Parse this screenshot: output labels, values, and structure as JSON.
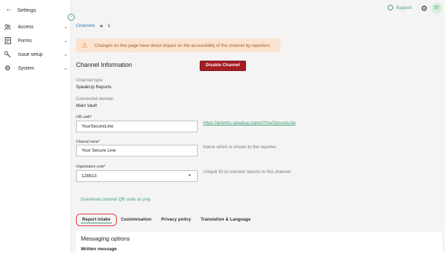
{
  "sidebar": {
    "title": "Settings",
    "items": [
      {
        "label": "Access",
        "icon": "users-icon"
      },
      {
        "label": "Forms",
        "icon": "form-icon"
      },
      {
        "label": "Issue setup",
        "icon": "wrench-icon"
      },
      {
        "label": "System",
        "icon": "gear-icon"
      }
    ]
  },
  "topbar": {
    "support_label": "Support",
    "avatar_initials": "ST"
  },
  "breadcrumb": {
    "root": "Channels",
    "current": "1"
  },
  "alert": {
    "text": "Changes on this page have direct impact on the accessibility of the channel by reporters."
  },
  "channel": {
    "section_title": "Channel Information",
    "disable_label": "Disable Channel",
    "type_label": "Channel type",
    "type_value": "SpeakUp Reports",
    "domain_label": "Connected domain",
    "domain_value": "Main Vault",
    "url_label": "URL path*",
    "url_value": "YourSecureLine",
    "url_link": "https://artemis.speakup.report/YourSecureLine",
    "name_label": "Channel name*",
    "name_value": "Your Secure Line",
    "name_help": "Name which is shown to the reporter.",
    "org_label": "Organisation code*",
    "org_value": "128913",
    "org_help": "Unique ID to connect reports to this channel.",
    "download_label": "Download channel QR code as png"
  },
  "tabs": [
    {
      "label": "Report intake"
    },
    {
      "label": "Customisation"
    },
    {
      "label": "Privacy policy"
    },
    {
      "label": "Translation & Language"
    }
  ],
  "messaging": {
    "title": "Messaging options",
    "subtitle": "Written message"
  },
  "colors": {
    "accent": "#3b9a6f",
    "danger": "#a31e22",
    "highlight": "#e0322f",
    "warning_bg": "#fbe3cf"
  }
}
